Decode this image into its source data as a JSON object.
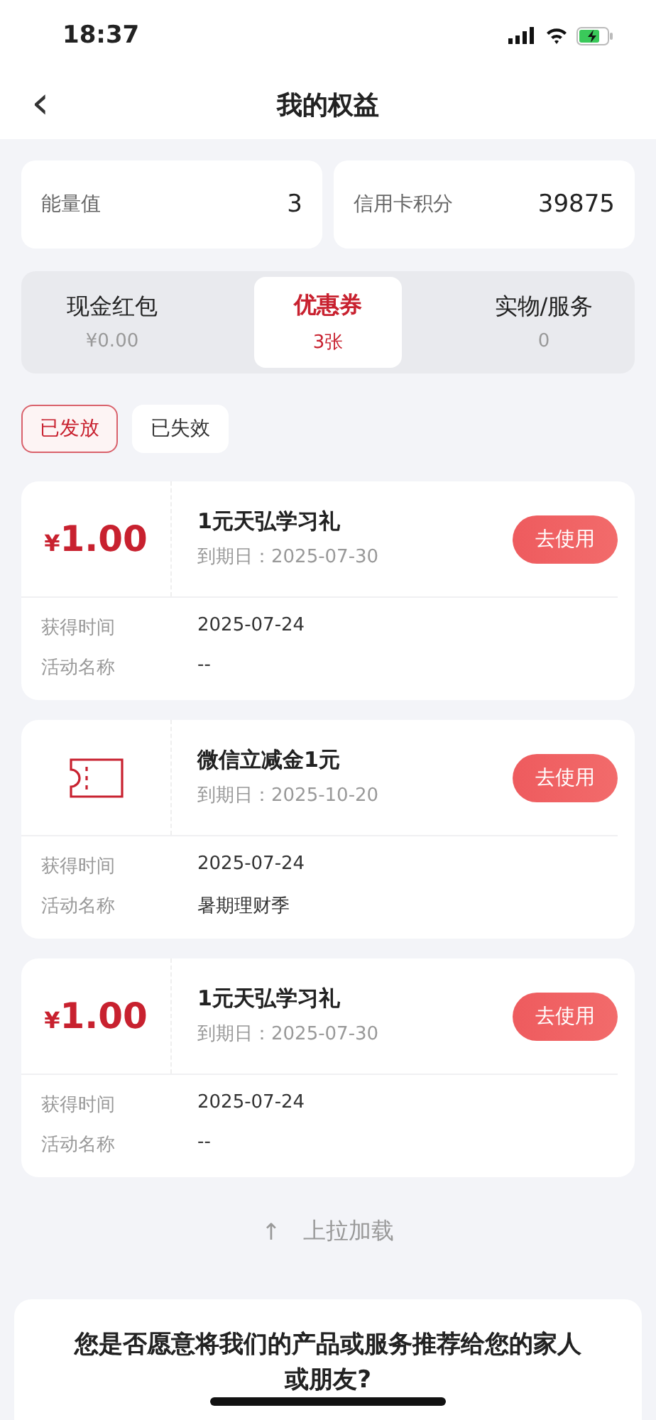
{
  "status_bar": {
    "time": "18:37"
  },
  "header": {
    "back": "‹",
    "title": "我的权益"
  },
  "stats": [
    {
      "label": "能量值",
      "value": "3"
    },
    {
      "label": "信用卡积分",
      "value": "39875"
    }
  ],
  "tabs": [
    {
      "label": "现金红包",
      "count": "¥0.00",
      "selected": false
    },
    {
      "label": "优惠券",
      "count": "3张",
      "selected": true
    },
    {
      "label": "实物/服务",
      "count": "0",
      "selected": false
    }
  ],
  "filters": [
    {
      "label": "已发放",
      "selected": true
    },
    {
      "label": "已失效",
      "selected": false
    }
  ],
  "coupons": [
    {
      "kind": "amount",
      "currency": "¥",
      "amount": "1.00",
      "title": "1元天弘学习礼",
      "expiry": "到期日：2025-07-30",
      "button": "去使用",
      "rows": [
        {
          "label": "获得时间",
          "value": "2025-07-24"
        },
        {
          "label": "活动名称",
          "value": "--"
        }
      ]
    },
    {
      "kind": "ticket",
      "title": "微信立减金1元",
      "expiry": "到期日：2025-10-20",
      "button": "去使用",
      "rows": [
        {
          "label": "获得时间",
          "value": "2025-07-24"
        },
        {
          "label": "活动名称",
          "value": "暑期理财季"
        }
      ]
    },
    {
      "kind": "amount",
      "currency": "¥",
      "amount": "1.00",
      "title": "1元天弘学习礼",
      "expiry": "到期日：2025-07-30",
      "button": "去使用",
      "rows": [
        {
          "label": "获得时间",
          "value": "2025-07-24"
        },
        {
          "label": "活动名称",
          "value": "--"
        }
      ]
    }
  ],
  "load_more": {
    "arrow": "↑",
    "label": "上拉加载"
  },
  "survey": {
    "question": "您是否愿意将我们的产品或服务推荐给您的家人或朋友?"
  }
}
